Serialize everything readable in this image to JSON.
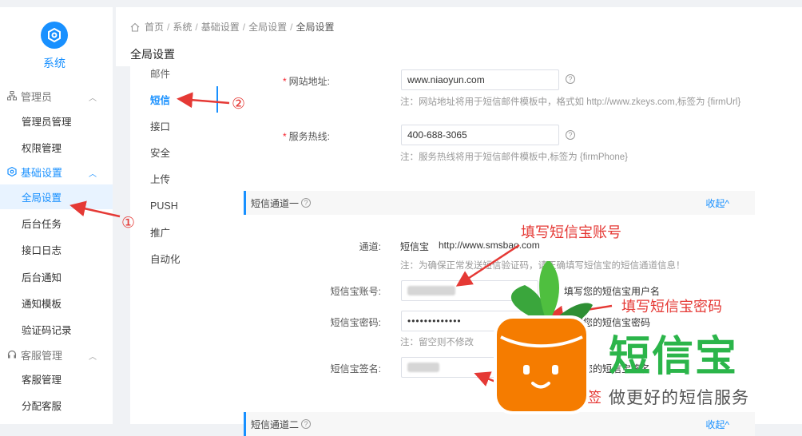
{
  "sidebar": {
    "title": "系统",
    "groups": [
      {
        "label": "管理员",
        "items": [
          "管理员管理",
          "权限管理"
        ]
      },
      {
        "label": "基础设置",
        "items": [
          "全局设置",
          "后台任务",
          "接口日志",
          "后台通知",
          "通知模板",
          "验证码记录"
        ]
      },
      {
        "label": "客服管理",
        "items": [
          "客服管理",
          "分配客服"
        ]
      }
    ]
  },
  "breadcrumb": [
    "首页",
    "系统",
    "基础设置",
    "全局设置",
    "全局设置"
  ],
  "page_title": "全局设置",
  "subnav": [
    "邮件",
    "短信",
    "接口",
    "安全",
    "上传",
    "PUSH",
    "推广",
    "自动化"
  ],
  "form": {
    "website_label": "网站地址:",
    "website_value": "www.niaoyun.com",
    "website_note": "注：网站地址将用于短信邮件模板中，格式如 http://www.zkeys.com,标签为 {firmUrl}",
    "hotline_label": "服务热线:",
    "hotline_value": "400-688-3065",
    "hotline_note": "注：服务热线将用于短信邮件模板中,标签为 {firmPhone}",
    "section1_title": "短信通道一",
    "section_toggle": "收起",
    "channel_label": "通道:",
    "channel_name": "短信宝",
    "channel_url": "http://www.smsbao.com",
    "channel_note": "注：为确保正常发送短信验证码，请正确填写短信宝的短信通道信息！",
    "account_label": "短信宝账号:",
    "account_hint": "填写您的短信宝用户名",
    "password_label": "短信宝密码:",
    "password_value": "•••••••••••••",
    "password_hint": "填写您的短信宝密码",
    "password_note": "注：留空则不修改",
    "sign_label": "短信宝签名:",
    "sign_hint": "填写您的短信宝签名",
    "section2_title": "短信通道二",
    "section2_toggle": "收起"
  },
  "annotations": {
    "marker1": "①",
    "marker2": "②",
    "callout_account": "填写短信宝账号",
    "callout_password": "填写短信宝密码",
    "callout_sign": "签"
  },
  "watermark": {
    "brand": "短信宝",
    "slogan": "做更好的短信服务"
  },
  "colors": {
    "primary": "#1890ff",
    "annotation": "#e53935",
    "brand_green": "#2bb54a",
    "brand_orange": "#f57c00"
  }
}
